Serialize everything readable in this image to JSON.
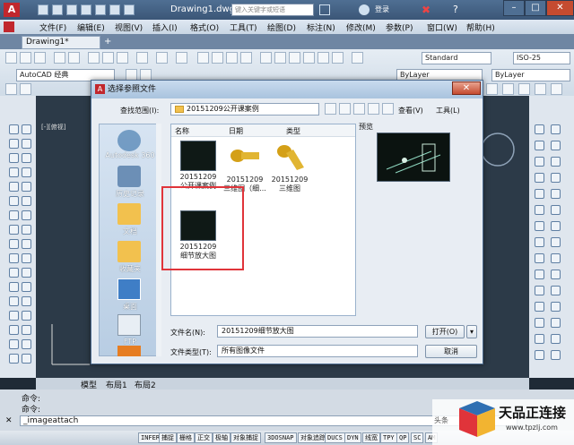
{
  "app": {
    "doc_title": "Drawing1.dwg",
    "search_placeholder": "键入关键字或短语",
    "login": "登录"
  },
  "menu": [
    "文件(F)",
    "编辑(E)",
    "视图(V)",
    "插入(I)",
    "格式(O)",
    "工具(T)",
    "绘图(D)",
    "标注(N)",
    "修改(M)",
    "参数(P)",
    "窗口(W)",
    "帮助(H)"
  ],
  "tabs": {
    "drawing": "Drawing1*"
  },
  "toolbar": {
    "workspace": "AutoCAD 经典",
    "text_style": "Standard",
    "dim_style": "ISO-25",
    "layer": "ByLayer",
    "linetype": "ByLayer"
  },
  "dialog": {
    "title": "选择参照文件",
    "look_in_label": "查找范围(I):",
    "look_in_value": "20151209公开课案例",
    "view_label": "查看(V)",
    "tools_label": "工具(L)",
    "columns": {
      "name": "名称",
      "date": "日期",
      "type": "类型"
    },
    "preview_label": "预览",
    "places": [
      "Autodesk 360",
      "历史记录",
      "文档",
      "收藏夹",
      "桌面",
      "FTP",
      ""
    ],
    "files": [
      {
        "name": "20151209公开课案例",
        "kind": "drawing"
      },
      {
        "name": "20151209三维图（细...",
        "kind": "bolt"
      },
      {
        "name": "20151209三维图",
        "kind": "bolt"
      },
      {
        "name": "20151209细节放大图",
        "kind": "drawing"
      }
    ],
    "filename_label": "文件名(N):",
    "filename_value": "20151209细节放大图",
    "filetype_label": "文件类型(T):",
    "filetype_value": "所有图像文件",
    "open_label": "打开(O)",
    "cancel_label": "取消"
  },
  "layouts": [
    "模型",
    "布局1",
    "布局2"
  ],
  "command": {
    "line1": "命令:",
    "line2": "命令:",
    "input": "_imageattach"
  },
  "status": [
    "INFER",
    "捕捉",
    "栅格",
    "正交",
    "极轴",
    "对象捕捉",
    "3DOSNAP",
    "对象追踪",
    "DUCS",
    "DYN",
    "线宽",
    "TPY",
    "QP",
    "SC",
    "AM"
  ],
  "watermark": {
    "brand": "天品正连接",
    "site": "www.tpzlj.com",
    "caption": "头条"
  },
  "colors": {
    "highlight": "#e0343a",
    "titlebar": "#3b5677",
    "canvas": "#2c3a48"
  }
}
